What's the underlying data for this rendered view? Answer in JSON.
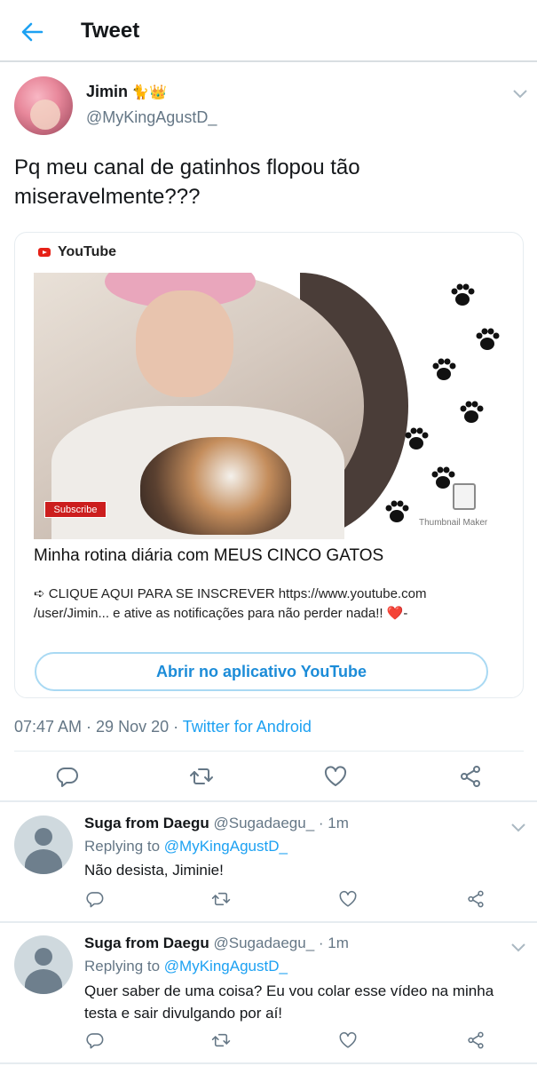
{
  "header": {
    "title": "Tweet"
  },
  "tweet": {
    "author_name": "Jimin",
    "author_emoji": "🐈👑",
    "author_handle": "@MyKingAgustD_",
    "text": "Pq meu canal de gatinhos flopou tão miseravelmente???",
    "timestamp": "07:47 AM · 29 Nov 20 · ",
    "via": "Twitter for Android"
  },
  "card": {
    "brand": "YouTube",
    "subscribe_badge": "Subscribe",
    "watermark": "Thumbnail Maker",
    "title": "Minha rotina diária com MEUS CINCO GATOS",
    "desc_line1": "➪ CLIQUE AQUI PARA SE INSCREVER https://www.youtube.com",
    "desc_line2": "/user/Jimin...     e ative as notificações para não perder nada!! ",
    "desc_heart": "❤️",
    "desc_tail": "-",
    "open_button": "Abrir no aplicativo YouTube"
  },
  "replies": [
    {
      "name": "Suga from Daegu",
      "handle": "@Sugadaegu_ · 1m",
      "replying_prefix": "Replying to ",
      "replying_to": "@MyKingAgustD_",
      "text": "Não desista, Jiminie!"
    },
    {
      "name": "Suga from Daegu",
      "handle": "@Sugadaegu_ · 1m",
      "replying_prefix": "Replying to ",
      "replying_to": "@MyKingAgustD_",
      "text": "Quer saber de uma coisa? Eu vou colar esse vídeo na minha testa e sair divulgando por aí!"
    }
  ],
  "icons": {
    "back": "arrow-left-icon",
    "reply": "reply-icon",
    "retweet": "retweet-icon",
    "like": "heart-icon",
    "share": "share-icon",
    "more": "chevron-down-icon"
  },
  "colors": {
    "accent": "#1da1f2",
    "muted": "#657786",
    "text": "#14171a",
    "youtube_red": "#e62117"
  }
}
